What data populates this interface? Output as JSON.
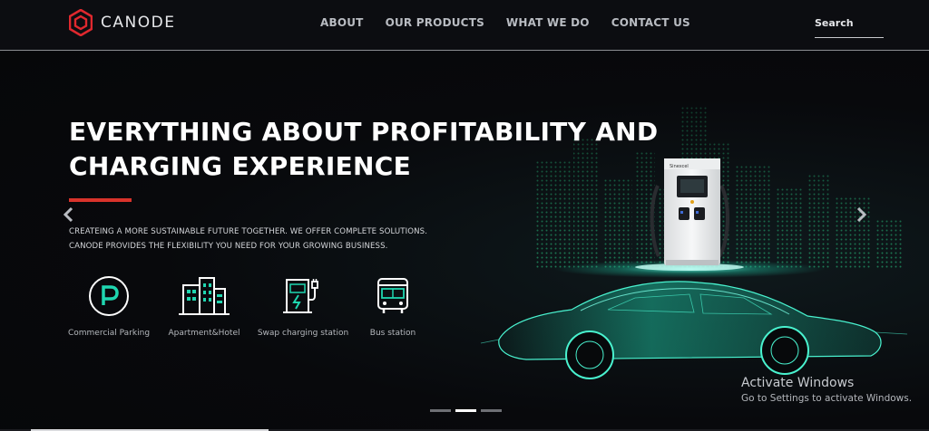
{
  "brand": {
    "name": "CANODE",
    "logo_icon": "hexagon-logo-icon",
    "logo_color": "#e0282e"
  },
  "nav": {
    "items": [
      "ABOUT",
      "OUR PRODUCTS",
      "WHAT WE DO",
      "CONTACT US"
    ]
  },
  "search": {
    "placeholder": "Search",
    "value": ""
  },
  "hero": {
    "headline_line1": "EVERYTHING ABOUT PROFITABILITY AND",
    "headline_line2": "CHARGING EXPERIENCE",
    "subtext_line1": "CREATEING A MORE SUSTAINABLE FUTURE TOGETHER. WE OFFER COMPLETE SOLUTIONS.",
    "subtext_line2": "CANODE PROVIDES THE FLEXIBILITY YOU NEED FOR YOUR GROWING BUSINESS.",
    "accent_color": "#d9332b",
    "glow_color": "#1fd6b0",
    "charger_brand": "Sinexcel",
    "features": [
      {
        "label": "Commercial Parking",
        "icon": "parking-icon"
      },
      {
        "label": "Apartment&Hotel",
        "icon": "building-icon"
      },
      {
        "label": "Swap charging station",
        "icon": "charging-station-icon"
      },
      {
        "label": "Bus station",
        "icon": "bus-icon"
      }
    ],
    "prev_icon": "chevron-left-icon",
    "next_icon": "chevron-right-icon"
  },
  "carousel": {
    "slides": 3,
    "active_index": 1
  },
  "watermark": {
    "title": "Activate Windows",
    "subtitle": "Go to Settings to activate Windows."
  }
}
